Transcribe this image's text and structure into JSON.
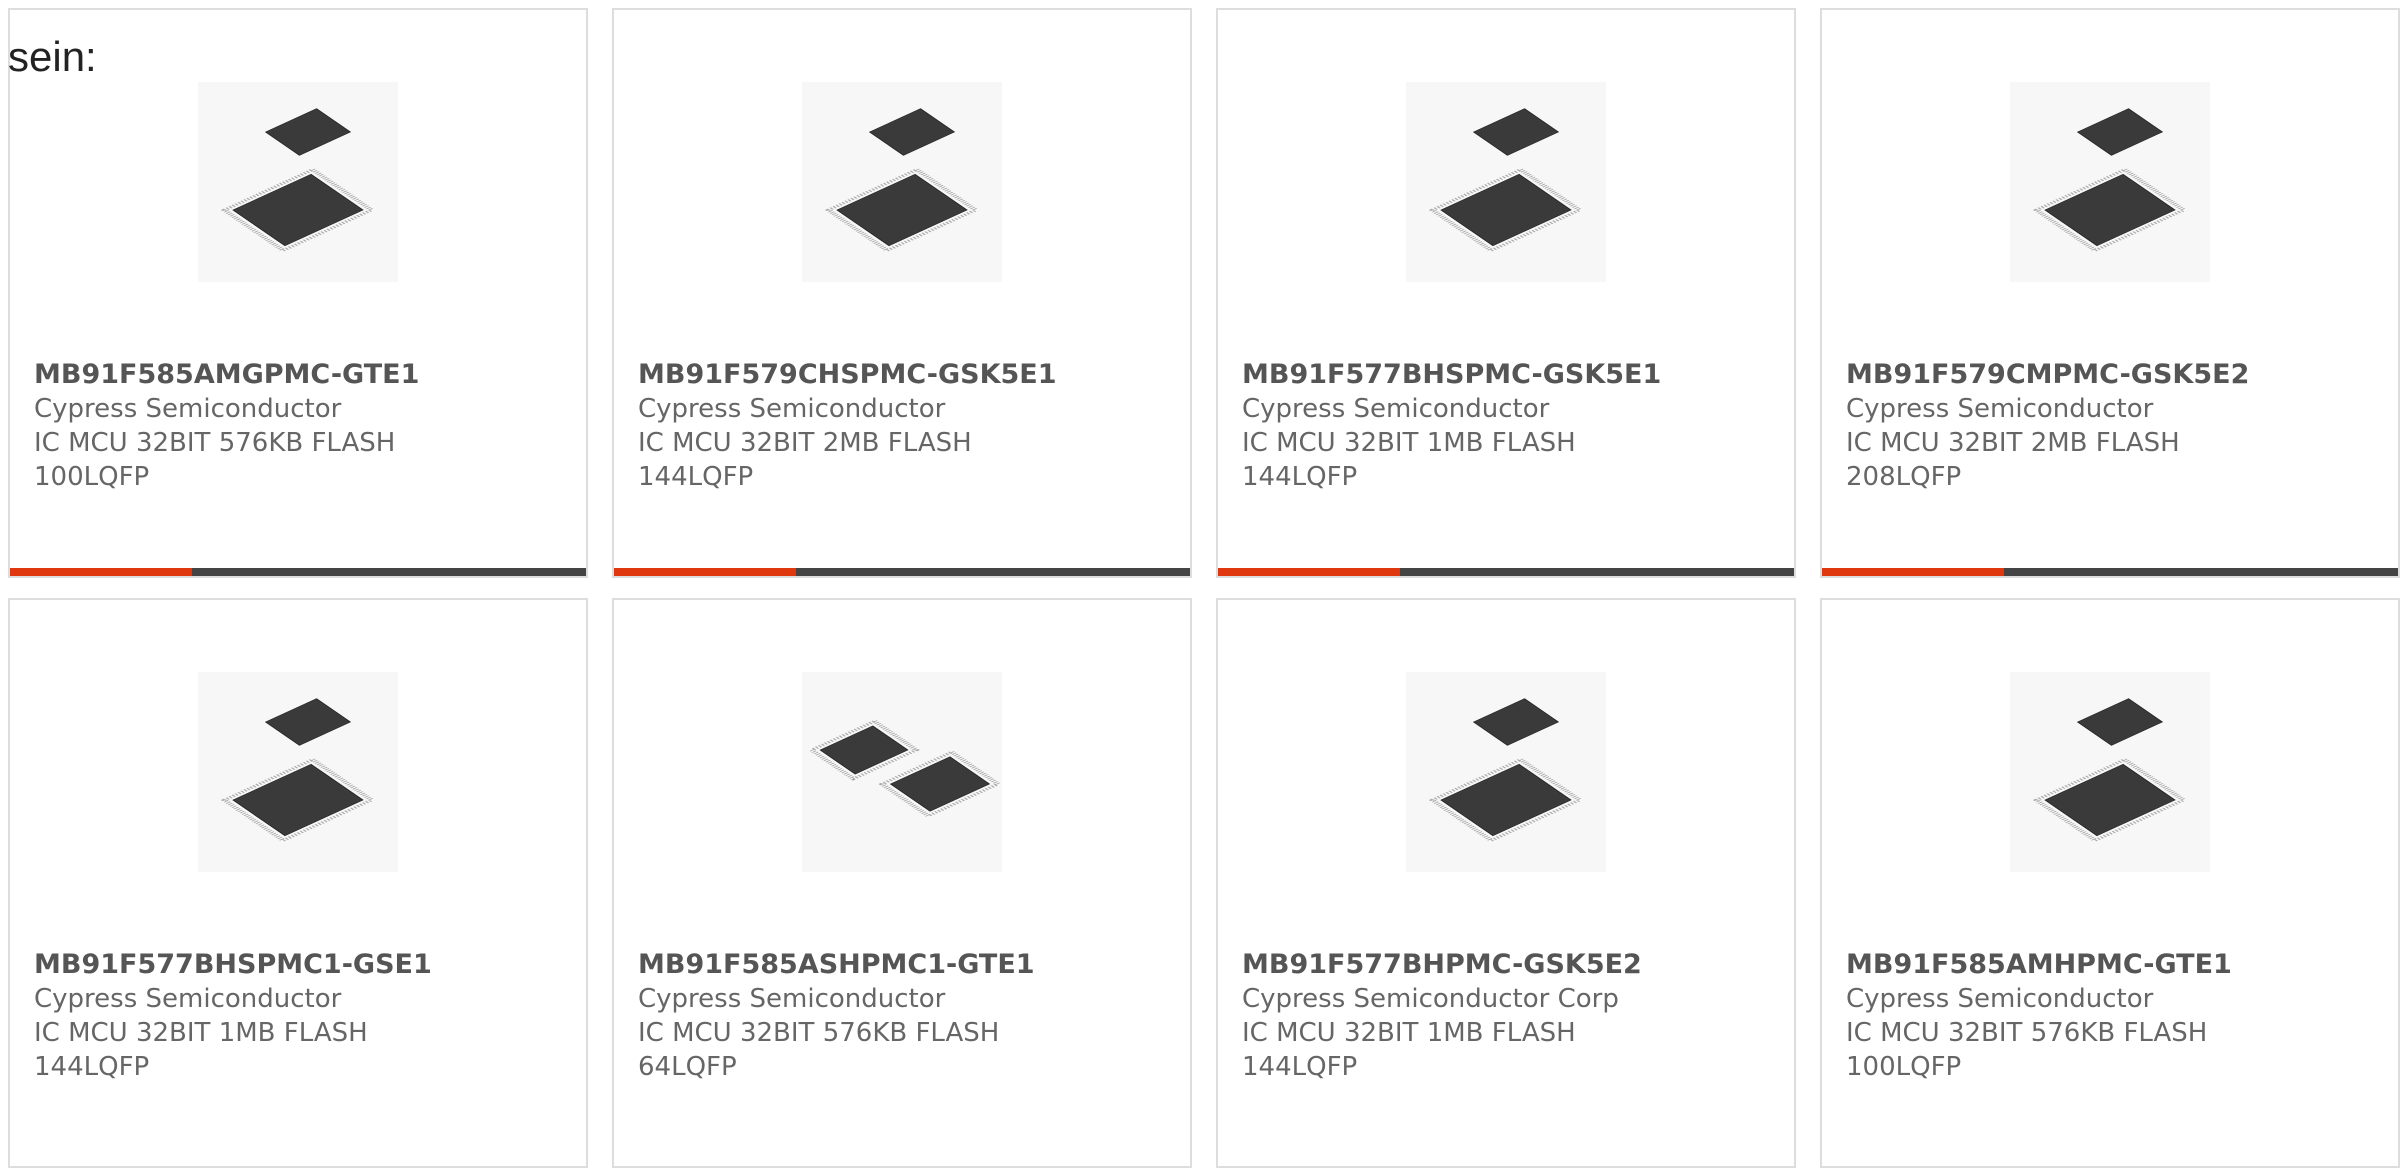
{
  "intro_text": "sein:",
  "accent_color": "#e0380e",
  "products": [
    {
      "part": "MB91F585AMGPMC-GTE1",
      "maker": "Cypress Semiconductor",
      "desc1": "IC MCU 32BIT 576KB FLASH",
      "desc2": "100LQFP",
      "image": "lqfp-chip-pair-icon"
    },
    {
      "part": "MB91F579CHSPMC-GSK5E1",
      "maker": "Cypress Semiconductor",
      "desc1": "IC MCU 32BIT 2MB FLASH",
      "desc2": "144LQFP",
      "image": "lqfp-chip-pair-icon"
    },
    {
      "part": "MB91F577BHSPMC-GSK5E1",
      "maker": "Cypress Semiconductor",
      "desc1": "IC MCU 32BIT 1MB FLASH",
      "desc2": "144LQFP",
      "image": "lqfp-chip-pair-icon"
    },
    {
      "part": "MB91F579CMPMC-GSK5E2",
      "maker": "Cypress Semiconductor",
      "desc1": "IC MCU 32BIT 2MB FLASH",
      "desc2": "208LQFP",
      "image": "lqfp-chip-pair-icon"
    },
    {
      "part": "MB91F577BHSPMC1-GSE1",
      "maker": "Cypress Semiconductor",
      "desc1": "IC MCU 32BIT 1MB FLASH",
      "desc2": "144LQFP",
      "image": "lqfp-chip-pair-icon"
    },
    {
      "part": "MB91F585ASHPMC1-GTE1",
      "maker": "Cypress Semiconductor",
      "desc1": "IC MCU 32BIT 576KB FLASH",
      "desc2": "64LQFP",
      "image": "lqfp-chip-pair-icon"
    },
    {
      "part": "MB91F577BHPMC-GSK5E2",
      "maker": "Cypress Semiconductor Corp",
      "desc1": "IC MCU 32BIT 1MB FLASH",
      "desc2": "144LQFP",
      "image": "lqfp-chip-pair-icon"
    },
    {
      "part": "MB91F585AMHPMC-GTE1",
      "maker": "Cypress Semiconductor",
      "desc1": "IC MCU 32BIT 576KB FLASH",
      "desc2": "100LQFP",
      "image": "lqfp-chip-pair-icon"
    }
  ]
}
